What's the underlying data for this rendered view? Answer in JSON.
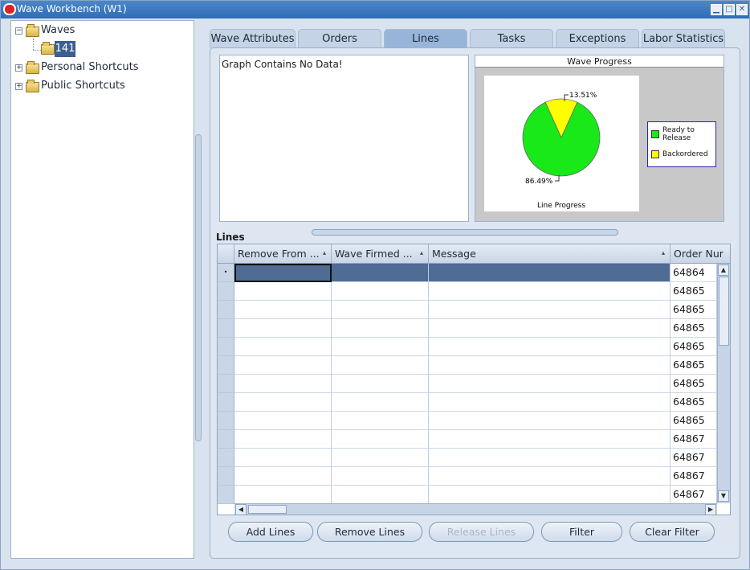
{
  "window": {
    "title": "Wave Workbench (W1)",
    "minimize": "▁",
    "maximize": "□",
    "close": "✕"
  },
  "navigator": {
    "items": [
      {
        "label": "Waves",
        "toggle": "−"
      },
      {
        "label": "141"
      },
      {
        "label": "Personal Shortcuts",
        "toggle": "+"
      },
      {
        "label": "Public Shortcuts",
        "toggle": "+"
      }
    ]
  },
  "tabs": [
    {
      "label": "Wave Attributes"
    },
    {
      "label": "Orders"
    },
    {
      "label": "Lines"
    },
    {
      "label": "Tasks"
    },
    {
      "label": "Exceptions"
    },
    {
      "label": "Labor Statistics"
    }
  ],
  "graph_panel": {
    "message": "Graph Contains No Data!"
  },
  "wave_progress": {
    "title": "Wave Progress",
    "label_backordered_pct": "13.51%",
    "label_ready_pct": "86.49%",
    "caption": "Line Progress",
    "legend": {
      "ready": "Ready to Release",
      "ready_line1": "Ready to",
      "ready_line2": "Release",
      "backordered": "Backordered"
    },
    "colors": {
      "ready": "#19e819",
      "backordered": "#ffff00"
    }
  },
  "chart_data": {
    "type": "pie",
    "title": "Wave Progress",
    "xlabel": "Line Progress",
    "categories": [
      "Ready to Release",
      "Backordered"
    ],
    "values": [
      86.49,
      13.51
    ],
    "legend": "right"
  },
  "lines": {
    "section_label": "Lines",
    "columns": [
      "Remove From ...",
      "Wave Firmed ...",
      "Message",
      "Order Nur"
    ],
    "sort_mark": "▴",
    "current_row_marker": "•",
    "order_numbers": [
      "64864",
      "64865",
      "64865",
      "64865",
      "64865",
      "64865",
      "64865",
      "64865",
      "64865",
      "64867",
      "64867",
      "64867",
      "64867"
    ]
  },
  "scroll": {
    "up": "▲",
    "down": "▼",
    "left": "◀",
    "right": "▶"
  },
  "buttons": {
    "add_lines": "Add Lines",
    "remove_lines": "Remove Lines",
    "release_lines": "Release Lines",
    "filter": "Filter",
    "clear_filter": "Clear Filter"
  }
}
